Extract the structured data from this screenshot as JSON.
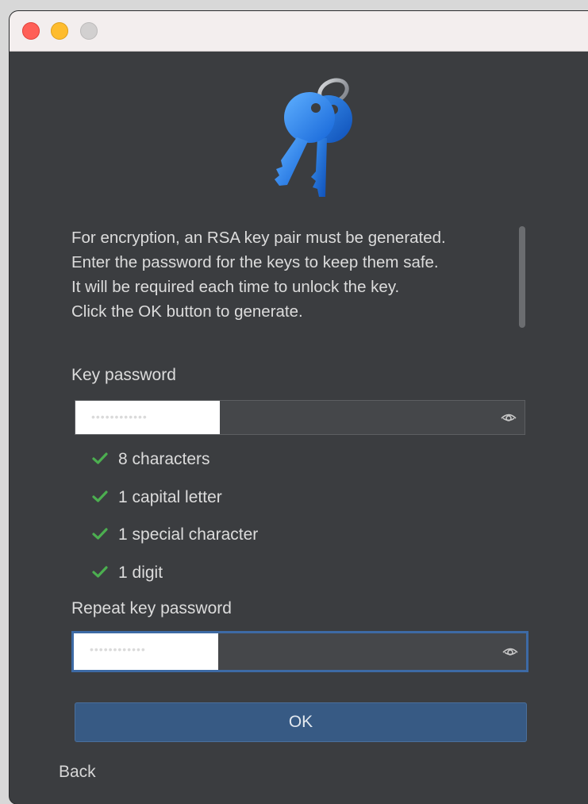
{
  "window": {
    "controls": [
      "close",
      "minimize",
      "maximize"
    ]
  },
  "header": {
    "icon": "keys-icon"
  },
  "info": {
    "lines": [
      "For encryption, an RSA key pair must be generated.",
      "Enter the password for the keys to keep them safe.",
      "It will be required each time to unlock the key.",
      "Click the OK button to generate."
    ]
  },
  "key_password": {
    "label": "Key password",
    "value": "••••••••••••",
    "show_icon": "eye-icon"
  },
  "requirements": [
    {
      "label": "8 characters",
      "met": true
    },
    {
      "label": "1 capital letter",
      "met": true
    },
    {
      "label": "1 special character",
      "met": true
    },
    {
      "label": "1 digit",
      "met": true
    }
  ],
  "repeat_password": {
    "label": "Repeat key password",
    "value": "••••••••••••",
    "show_icon": "eye-icon"
  },
  "actions": {
    "ok_label": "OK",
    "back_label": "Back"
  },
  "colors": {
    "background": "#3b3d40",
    "accent": "#375a84",
    "check": "#4caf50",
    "focus_border": "#3d6aa5"
  }
}
